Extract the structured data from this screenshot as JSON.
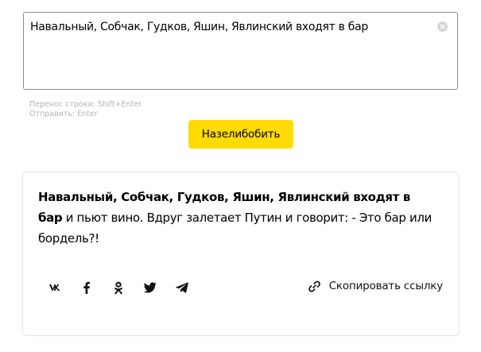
{
  "input": {
    "value": "Навальный, Собчак, Гудков, Яшин, Явлинский входят в бар"
  },
  "hints": {
    "line_break": "Перенос строки: Shift+Enter",
    "send": "Отправить: Enter"
  },
  "submit": {
    "label": "Назелибобить",
    "color": "#ffdb00"
  },
  "result": {
    "bold_part": "Навальный, Собчак, Гудков, Яшин, Явлинский входят в бар",
    "rest": " и пьют вино. Вдруг залетает Путин и говорит: - Это бар или бордель?!"
  },
  "share": {
    "icons": [
      "vk-icon",
      "facebook-icon",
      "odnoklassniki-icon",
      "twitter-icon",
      "telegram-icon"
    ],
    "copy_label": "Скопировать ссылку"
  }
}
